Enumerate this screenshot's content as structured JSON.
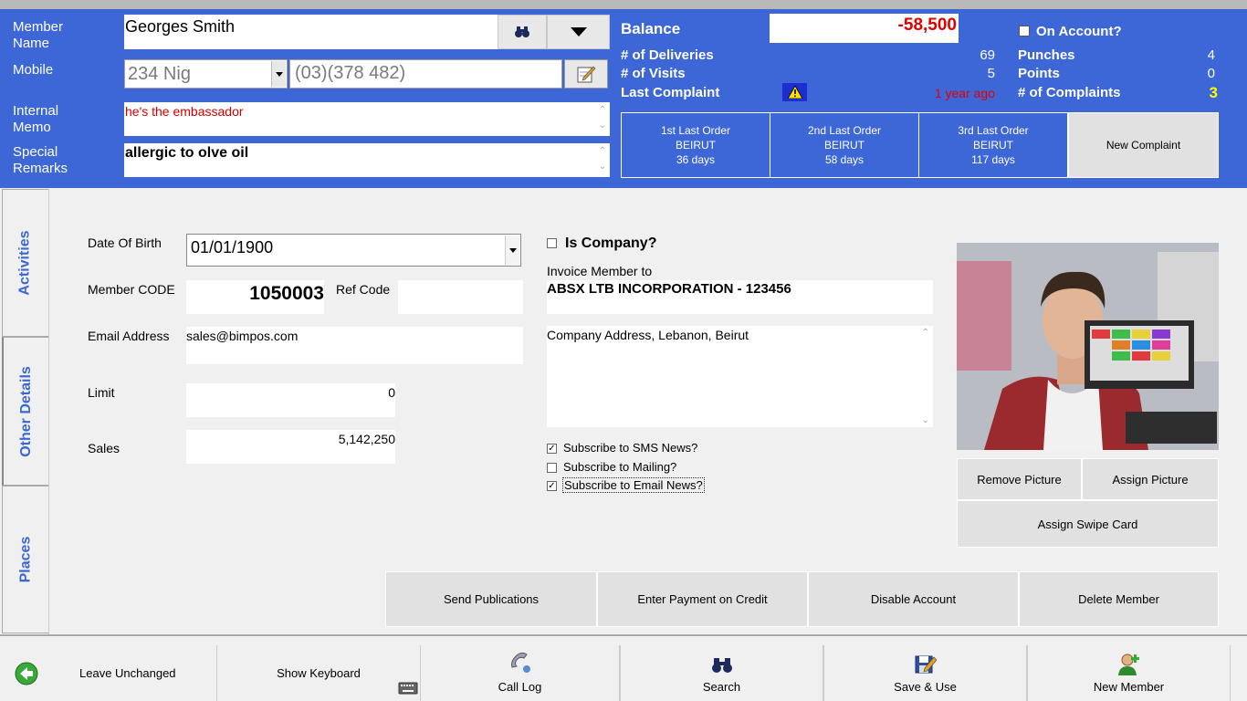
{
  "member": {
    "name_label": "Member Name",
    "name_value": "Georges Smith",
    "mobile_label": "Mobile",
    "country_code": "234 Nig",
    "mobile_value": "(03)(378 482)",
    "internal_memo_label": "Internal Memo",
    "internal_memo_value": "he's the embassador",
    "special_remarks_label": "Special Remarks",
    "special_remarks_value": "allergic to olve oil"
  },
  "stats": {
    "balance_label": "Balance",
    "balance_value": "-58,500",
    "on_account_label": "On Account?",
    "deliveries_label": "# of Deliveries",
    "deliveries_value": "69",
    "visits_label": "# of Visits",
    "visits_value": "5",
    "last_complaint_label": "Last Complaint",
    "last_complaint_value": "1 year ago",
    "punches_label": "Punches",
    "punches_value": "4",
    "points_label": "Points",
    "points_value": "0",
    "complaints_label": "# of Complaints",
    "complaints_value": "3"
  },
  "orders": [
    {
      "title": "1st Last Order",
      "place": "BEIRUT",
      "ago": "36 days"
    },
    {
      "title": "2nd Last Order",
      "place": "BEIRUT",
      "ago": "58 days"
    },
    {
      "title": "3rd Last Order",
      "place": "BEIRUT",
      "ago": "117 days"
    }
  ],
  "new_complaint_label": "New Complaint",
  "tabs": [
    "Activities",
    "Other Details",
    "Places"
  ],
  "details": {
    "dob_label": "Date Of Birth",
    "dob_value": "01/01/1900",
    "code_label": "Member CODE",
    "code_value": "1050003",
    "ref_label": "Ref Code",
    "ref_value": "",
    "email_label": "Email Address",
    "email_value": "sales@bimpos.com",
    "limit_label": "Limit",
    "limit_value": "0",
    "sales_label": "Sales",
    "sales_value": "5,142,250",
    "is_company_label": "Is Company?",
    "invoice_label": "Invoice Member to",
    "invoice_value": "ABSX LTB INCORPORATION - 123456",
    "address_value": "Company Address, Lebanon, Beirut",
    "sms_label": "Subscribe to SMS News?",
    "mailing_label": "Subscribe to Mailing?",
    "emailnews_label": "Subscribe to Email News?"
  },
  "picture_buttons": {
    "remove": "Remove Picture",
    "assign": "Assign Picture",
    "swipe": "Assign Swipe Card"
  },
  "action_buttons": [
    "Send Publications",
    "Enter Payment on Credit",
    "Disable Account",
    "Delete Member"
  ],
  "bottom": {
    "leave": "Leave Unchanged",
    "keyboard": "Show Keyboard",
    "calllog": "Call Log",
    "search": "Search",
    "save": "Save & Use",
    "new": "New Member"
  },
  "colors": {
    "header": "#3d67d6",
    "balance": "#e00000",
    "complaints": "#ffff00",
    "tab_text": "#3b67d3"
  }
}
